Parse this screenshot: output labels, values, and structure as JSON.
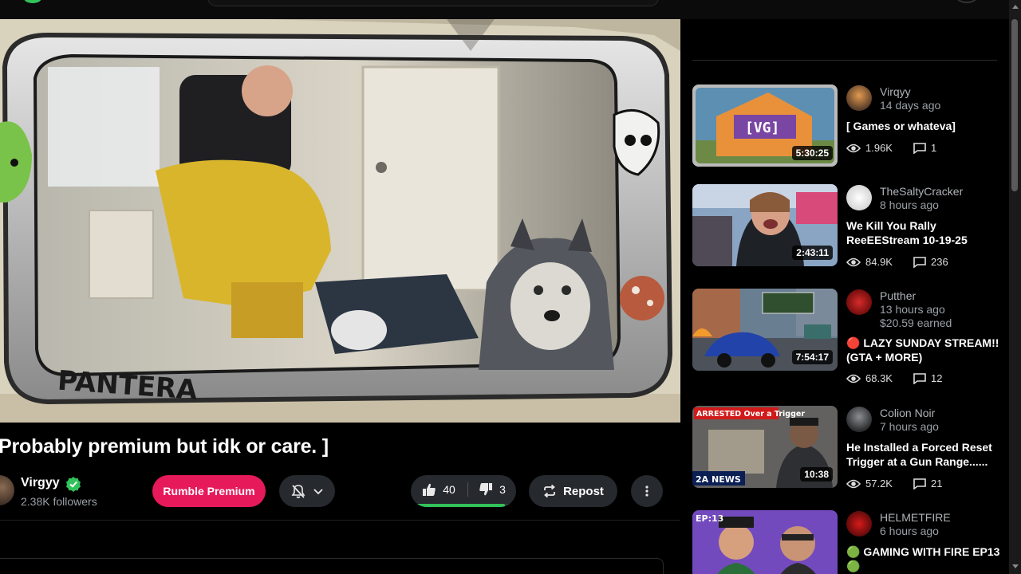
{
  "video": {
    "title": "Probably premium but idk or care. ]",
    "overlay_text": "PANTERA",
    "channel": {
      "name": "Virgyy",
      "followers": "2.38K followers"
    },
    "buttons": {
      "premium_label": "Rumble Premium",
      "repost_label": "Repost",
      "likes": "40",
      "dislikes": "3",
      "like_ratio_percent": 93
    }
  },
  "sidebar": {
    "recommendations": [
      {
        "channel": "Virqyy",
        "time": "14 days ago",
        "extra": "",
        "title": "[ Games or whateva]",
        "views": "1.96K",
        "comments": "1",
        "duration": "5:30:25",
        "thumb_text": "[VG]"
      },
      {
        "channel": "TheSaltyCracker",
        "time": "8 hours ago",
        "extra": "",
        "title": "We Kill You Rally ReeEEStream 10-19-25",
        "views": "84.9K",
        "comments": "236",
        "duration": "2:43:11",
        "thumb_text": ""
      },
      {
        "channel": "Putther",
        "time": "13 hours ago",
        "extra": "$20.59 earned",
        "title": "🔴 LAZY SUNDAY STREAM!! (GTA + MORE)",
        "views": "68.3K",
        "comments": "12",
        "duration": "7:54:17",
        "thumb_text": ""
      },
      {
        "channel": "Colion Noir",
        "time": "7 hours ago",
        "extra": "",
        "title": "He Installed a Forced Reset Trigger at a Gun Range......",
        "views": "57.2K",
        "comments": "21",
        "duration": "10:38",
        "thumb_text": "ARRESTED Over a Trigger",
        "thumb_text2": "2A NEWS"
      },
      {
        "channel": "HELMETFIRE",
        "time": "6 hours ago",
        "extra": "",
        "title": "🟢 GAMING WITH FIRE EP13 🟢",
        "views": "",
        "comments": "",
        "duration": "",
        "thumb_text": "EP:13"
      }
    ]
  },
  "icons": {
    "verified": "verified-check-icon",
    "eye": "eye-icon",
    "comment": "comment-icon",
    "thumbs_up": "thumbs-up-icon",
    "thumbs_down": "thumbs-down-icon",
    "bell_off": "bell-off-icon",
    "repost": "repost-icon",
    "more": "more-vertical-icon"
  },
  "colors": {
    "accent_green": "#31c25a",
    "premium_pink": "#e6195a",
    "button_bg": "#26292e"
  }
}
